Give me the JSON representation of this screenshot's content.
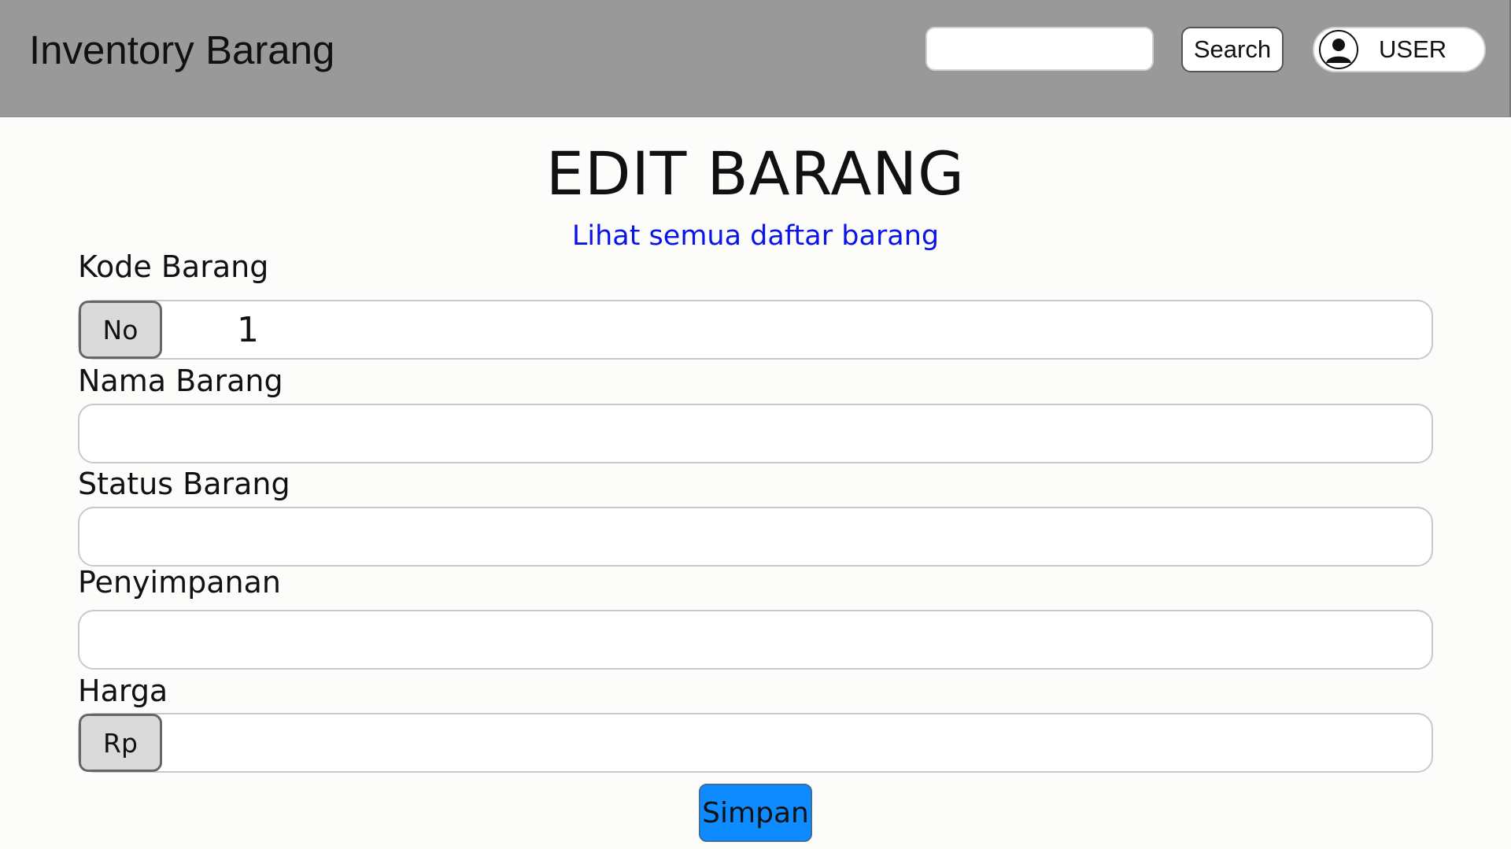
{
  "header": {
    "app_title": "Inventory Barang",
    "search": {
      "placeholder": "",
      "value": ""
    },
    "search_button_label": "Search",
    "user_label": "USER"
  },
  "page": {
    "title": "EDIT BARANG",
    "list_link": "Lihat semua daftar barang"
  },
  "form": {
    "kode": {
      "label": "Kode Barang",
      "addon": "No",
      "value": "1"
    },
    "nama": {
      "label": "Nama Barang",
      "value": ""
    },
    "status": {
      "label": "Status Barang",
      "value": ""
    },
    "penyimpanan": {
      "label": "Penyimpanan",
      "value": ""
    },
    "harga": {
      "label": "Harga",
      "addon": "Rp",
      "value": ""
    },
    "save_label": "Simpan"
  },
  "colors": {
    "header_bg": "#999999",
    "link": "#0a14e8",
    "save_button": "#0d8bff"
  },
  "icons": {
    "user": "user-avatar-icon"
  }
}
